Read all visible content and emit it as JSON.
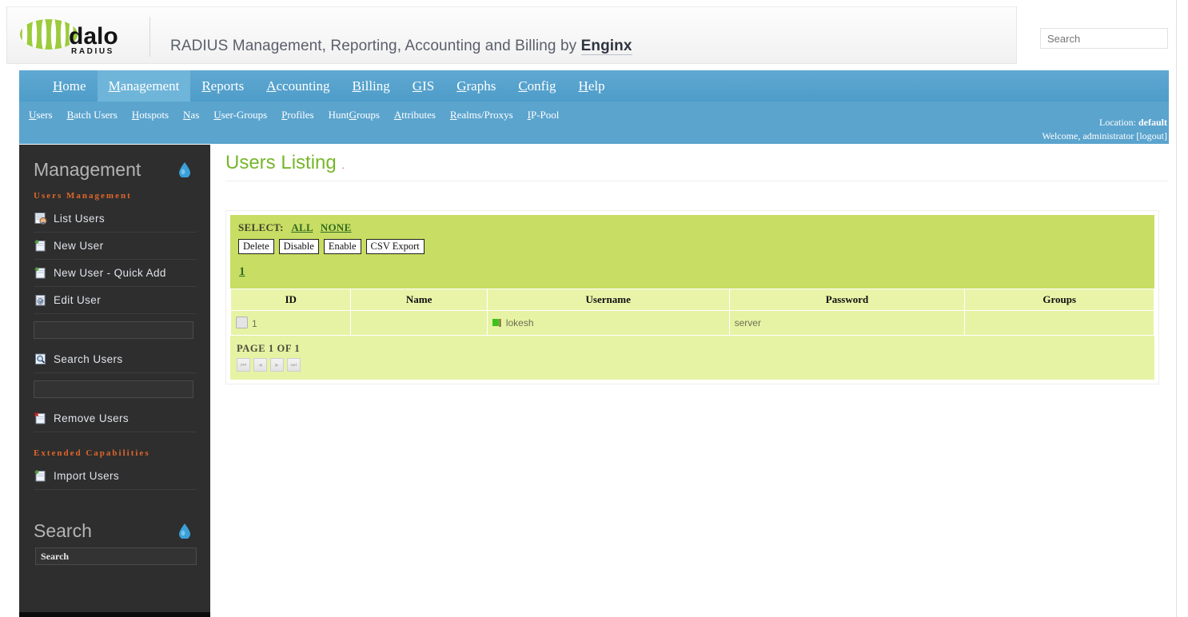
{
  "header": {
    "logo_text_main": "dalo",
    "logo_text_sub": "R A D I U S",
    "title_prefix": "RADIUS Management, Reporting, Accounting and Billing by ",
    "title_brand": "Enginx",
    "search_placeholder": "Search",
    "search_value": ""
  },
  "mainnav": {
    "items": [
      {
        "label": "Home",
        "accesskey": "H",
        "active": false
      },
      {
        "label": "Management",
        "accesskey": "M",
        "active": true
      },
      {
        "label": "Reports",
        "accesskey": "R",
        "active": false
      },
      {
        "label": "Accounting",
        "accesskey": "A",
        "active": false
      },
      {
        "label": "Billing",
        "accesskey": "B",
        "active": false
      },
      {
        "label": "GIS",
        "accesskey": "G",
        "active": false
      },
      {
        "label": "Graphs",
        "accesskey": "G",
        "active": false
      },
      {
        "label": "Config",
        "accesskey": "C",
        "active": false
      },
      {
        "label": "Help",
        "accesskey": "H",
        "active": false
      }
    ]
  },
  "subnav": {
    "items": [
      {
        "label": "Users",
        "ak_index": 0
      },
      {
        "label": "Batch Users",
        "ak_index": 0
      },
      {
        "label": "Hotspots",
        "ak_index": 0
      },
      {
        "label": "Nas",
        "ak_index": 0
      },
      {
        "label": "User-Groups",
        "ak_index": 0
      },
      {
        "label": "Profiles",
        "ak_index": 0
      },
      {
        "label": "HuntGroups",
        "ak_index": 4
      },
      {
        "label": "Attributes",
        "ak_index": 0
      },
      {
        "label": "Realms/Proxys",
        "ak_index": 0
      },
      {
        "label": "IP-Pool",
        "ak_index": 0
      }
    ]
  },
  "status": {
    "location_label": "Location:",
    "location_value": "default",
    "welcome": "Welcome, administrator",
    "logout": "[logout]"
  },
  "sidebar": {
    "title": "Management",
    "section_users": "Users Management",
    "section_extended": "Extended Capabilities",
    "items_users": [
      {
        "label": "List Users",
        "icon": "list-users-icon"
      },
      {
        "label": "New User",
        "icon": "new-page-icon"
      },
      {
        "label": "New User - Quick Add",
        "icon": "new-page-icon"
      },
      {
        "label": "Edit User",
        "icon": "edit-page-icon"
      }
    ],
    "edit_user_input_value": "",
    "search_users": {
      "label": "Search Users",
      "icon": "search-page-icon",
      "input_value": ""
    },
    "remove_users": {
      "label": "Remove Users",
      "icon": "remove-page-icon"
    },
    "items_extended": [
      {
        "label": "Import Users",
        "icon": "import-page-icon"
      }
    ],
    "search_panel": {
      "title": "Search",
      "input_value": "Search"
    }
  },
  "main": {
    "page_title": "Users Listing",
    "title_dot": ".",
    "toolbar": {
      "select_label": "SELECT:",
      "select_all": "ALL",
      "select_none": "NONE",
      "buttons": [
        "Delete",
        "Disable",
        "Enable",
        "CSV Export"
      ],
      "page_link": "1"
    },
    "table": {
      "columns": [
        "ID",
        "Name",
        "Username",
        "Password",
        "Groups"
      ],
      "rows": [
        {
          "id": "1",
          "name": "",
          "username": "lokesh",
          "password": "server",
          "groups": "",
          "checked": false,
          "status_icon": "user-online-icon"
        }
      ]
    },
    "footer": {
      "page_of": "PAGE 1 OF 1",
      "buttons": [
        "first-page",
        "prev-page",
        "next-page",
        "last-page"
      ],
      "glyphs": [
        "⏮",
        "◂",
        "▸",
        "⏭"
      ]
    }
  },
  "colors": {
    "nav_blue": "#5ba4ce",
    "sidebar_dark": "#2e2e2e",
    "accent_orange": "#e0662a",
    "title_green": "#77b62b",
    "toolbar_green": "#c8dd63",
    "table_green": "#e6f3a4"
  }
}
